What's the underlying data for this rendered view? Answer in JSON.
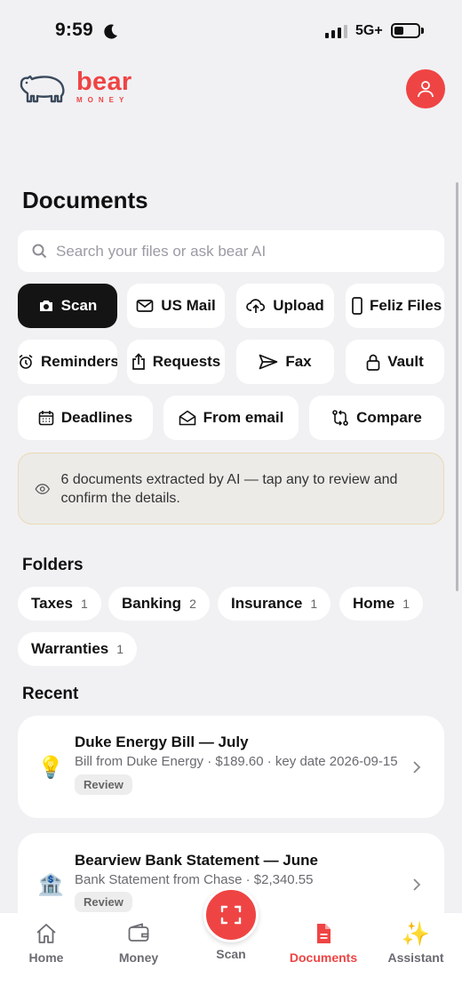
{
  "status": {
    "time": "9:59",
    "network": "5G+"
  },
  "brand": {
    "name": "bear",
    "sub": "MONEY"
  },
  "page": {
    "title": "Documents"
  },
  "search": {
    "placeholder": "Search your files or ask bear AI"
  },
  "actions": [
    {
      "label": "Scan",
      "icon": "camera-icon",
      "active": true
    },
    {
      "label": "US Mail",
      "icon": "mail-icon"
    },
    {
      "label": "Upload",
      "icon": "cloud-upload-icon"
    },
    {
      "label": "Feliz Files",
      "icon": "phone-icon"
    },
    {
      "label": "Reminders",
      "icon": "alarm-clock-icon"
    },
    {
      "label": "Requests",
      "icon": "share-icon"
    },
    {
      "label": "Fax",
      "icon": "send-icon"
    },
    {
      "label": "Vault",
      "icon": "lock-icon"
    },
    {
      "label": "Deadlines",
      "icon": "calendar-icon"
    },
    {
      "label": "From email",
      "icon": "open-mail-icon"
    },
    {
      "label": "Compare",
      "icon": "compare-icon"
    }
  ],
  "banner": {
    "text": "6 documents extracted by AI — tap any to review and confirm the details."
  },
  "folders": {
    "title": "Folders",
    "items": [
      {
        "label": "Taxes",
        "count": "1"
      },
      {
        "label": "Banking",
        "count": "2"
      },
      {
        "label": "Insurance",
        "count": "1"
      },
      {
        "label": "Home",
        "count": "1"
      },
      {
        "label": "Warranties",
        "count": "1"
      }
    ]
  },
  "recent": {
    "title": "Recent",
    "items": [
      {
        "icon": "💡",
        "title": "Duke Energy Bill — July",
        "subtitle": "Bill from Duke Energy · $189.60 · key date 2026-09-15",
        "badge": "Review"
      },
      {
        "icon": "🏦",
        "title": "Bearview Bank Statement — June",
        "subtitle": "Bank Statement from Chase · $2,340.55",
        "badge": "Review"
      }
    ]
  },
  "tabs": [
    {
      "label": "Home",
      "icon": "home-icon"
    },
    {
      "label": "Money",
      "icon": "wallet-icon"
    },
    {
      "label": "Scan",
      "icon": "scan-icon"
    },
    {
      "label": "Documents",
      "icon": "document-icon",
      "active": true
    },
    {
      "label": "Assistant",
      "icon": "sparkles-icon",
      "glyph": "✨"
    }
  ],
  "colors": {
    "accent": "#ef4444",
    "active_button": "#141414",
    "background": "#f1f1f4"
  }
}
